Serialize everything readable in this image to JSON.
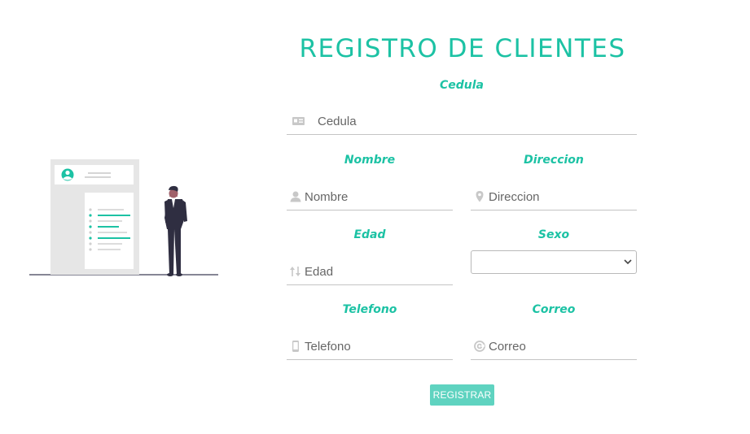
{
  "form": {
    "title": "REGISTRO DE CLIENTES",
    "fields": {
      "cedula": {
        "label": "Cedula",
        "placeholder": "Cedula",
        "icon": "id-card-icon"
      },
      "nombre": {
        "label": "Nombre",
        "placeholder": "Nombre",
        "icon": "user-icon"
      },
      "direccion": {
        "label": "Direccion",
        "placeholder": "Direccion",
        "icon": "map-marker-icon"
      },
      "edad": {
        "label": "Edad",
        "placeholder": "Edad",
        "icon": "sort-arrows-icon"
      },
      "sexo": {
        "label": "Sexo",
        "selected": ""
      },
      "telefono": {
        "label": "Telefono",
        "placeholder": "Telefono",
        "icon": "mobile-phone-icon"
      },
      "correo": {
        "label": "Correo",
        "placeholder": "Correo",
        "icon": "at-sign-icon"
      }
    },
    "submit_label": "REGISTRAR"
  },
  "colors": {
    "accent": "#1cc2a4",
    "button": "#5fd3c0",
    "illustration_figure": "#2f2e41"
  }
}
